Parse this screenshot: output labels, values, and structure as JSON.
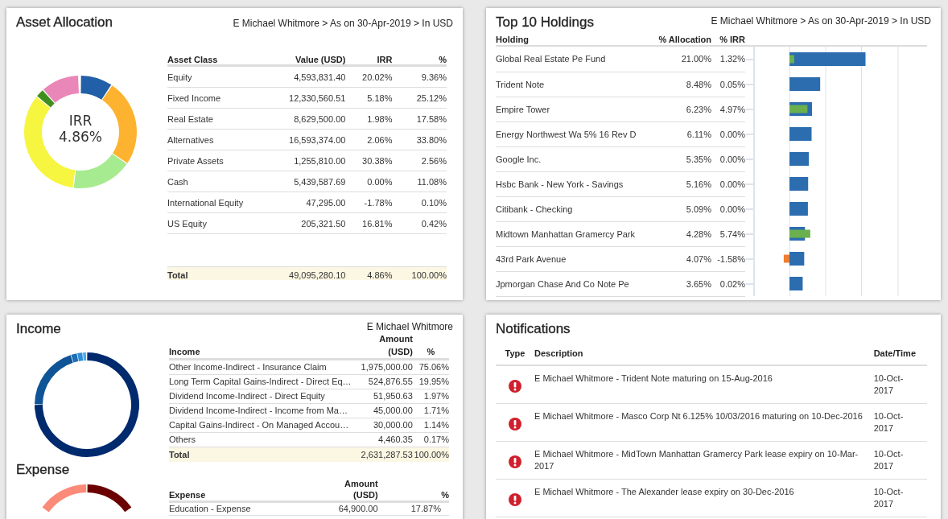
{
  "asset_allocation": {
    "title": "Asset Allocation",
    "breadcrumb": "E Michael Whitmore > As on 30-Apr-2019 > In USD",
    "irr_label": "IRR",
    "irr_value": "4.86%",
    "columns": [
      "Asset Class",
      "Value (USD)",
      "IRR",
      "%"
    ],
    "rows": [
      {
        "asset_class": "Equity",
        "value": "4,593,831.40",
        "irr": "20.02%",
        "percent": "9.36%"
      },
      {
        "asset_class": "Fixed Income",
        "value": "12,330,560.51",
        "irr": "5.18%",
        "percent": "25.12%"
      },
      {
        "asset_class": "Real Estate",
        "value": "8,629,500.00",
        "irr": "1.98%",
        "percent": "17.58%"
      },
      {
        "asset_class": "Alternatives",
        "value": "16,593,374.00",
        "irr": "2.06%",
        "percent": "33.80%"
      },
      {
        "asset_class": "Private Assets",
        "value": "1,255,810.00",
        "irr": "30.38%",
        "percent": "2.56%"
      },
      {
        "asset_class": "Cash",
        "value": "5,439,587.69",
        "irr": "0.00%",
        "percent": "11.08%"
      },
      {
        "asset_class": "International Equity",
        "value": "47,295.00",
        "irr": "-1.78%",
        "percent": "0.10%"
      },
      {
        "asset_class": "US Equity",
        "value": "205,321.50",
        "irr": "16.81%",
        "percent": "0.42%"
      }
    ],
    "total": {
      "label": "Total",
      "value": "49,095,280.10",
      "irr": "4.86%",
      "percent": "100.00%"
    }
  },
  "top_holdings": {
    "title": "Top 10 Holdings",
    "breadcrumb": "E Michael Whitmore > As on 30-Apr-2019 > In USD",
    "columns": [
      "Holding",
      "% Allocation",
      "% IRR"
    ],
    "rows": [
      {
        "holding": "Global Real Estate Pe Fund",
        "allocation": "21.00%",
        "irr": "1.32%"
      },
      {
        "holding": "Trident Note",
        "allocation": "8.48%",
        "irr": "0.05%"
      },
      {
        "holding": "Empire Tower",
        "allocation": "6.23%",
        "irr": "4.97%"
      },
      {
        "holding": "Energy Northwest Wa 5% 16 Rev D",
        "allocation": "6.11%",
        "irr": "0.00%"
      },
      {
        "holding": "Google Inc.",
        "allocation": "5.35%",
        "irr": "0.00%"
      },
      {
        "holding": "Hsbc Bank - New York - Savings",
        "allocation": "5.16%",
        "irr": "0.00%"
      },
      {
        "holding": "Citibank - Checking",
        "allocation": "5.09%",
        "irr": "0.00%"
      },
      {
        "holding": "Midtown Manhattan Gramercy Park",
        "allocation": "4.28%",
        "irr": "5.74%"
      },
      {
        "holding": "43rd Park Avenue",
        "allocation": "4.07%",
        "irr": "-1.58%"
      },
      {
        "holding": "Jpmorgan Chase And Co Note Pe",
        "allocation": "3.65%",
        "irr": "0.02%"
      }
    ]
  },
  "income": {
    "title": "Income",
    "breadcrumb": "E Michael Whitmore",
    "columns": [
      "Income",
      "Amount (USD)",
      "%"
    ],
    "rows": [
      {
        "income": "Other Income-Indirect - Insurance Claim",
        "amount": "1,975,000.00",
        "percent": "75.06%"
      },
      {
        "income": "Long Term Capital Gains-Indirect - Direct Eq…",
        "amount": "524,876.55",
        "percent": "19.95%"
      },
      {
        "income": "Dividend Income-Indirect - Direct Equity",
        "amount": "51,950.63",
        "percent": "1.97%"
      },
      {
        "income": "Dividend Income-Indirect - Income from Ma…",
        "amount": "45,000.00",
        "percent": "1.71%"
      },
      {
        "income": "Capital Gains-Indirect - On Managed Accou…",
        "amount": "30,000.00",
        "percent": "1.14%"
      },
      {
        "income": "Others",
        "amount": "4,460.35",
        "percent": "0.17%"
      }
    ],
    "total": {
      "label": "Total",
      "amount": "2,631,287.53",
      "percent": "100.00%"
    }
  },
  "expense": {
    "title": "Expense",
    "columns": [
      "Expense",
      "Amount (USD)",
      "%"
    ],
    "rows": [
      {
        "expense": "Education - Expense",
        "amount": "64,900.00",
        "percent": "17.87%"
      }
    ]
  },
  "notifications": {
    "title": "Notifications",
    "columns": [
      "Type",
      "Description",
      "Date/Time"
    ],
    "rows": [
      {
        "kind": "alert",
        "description": "E Michael Whitmore - Trident Note maturing on 15-Aug-2016",
        "datetime": "10-Oct-2017"
      },
      {
        "kind": "alert",
        "description": "E Michael Whitmore - Masco Corp Nt 6.125% 10/03/2016 maturing on 10-Dec-2016",
        "datetime": "10-Oct-2017"
      },
      {
        "kind": "alert",
        "description": "E Michael Whitmore - MidTown Manhattan Gramercy Park lease expiry on 10-Mar-2017",
        "datetime": "10-Oct-2017"
      },
      {
        "kind": "alert",
        "description": "E Michael Whitmore - The Alexander lease expiry on 30-Dec-2016",
        "datetime": "10-Oct-2017"
      }
    ]
  }
}
